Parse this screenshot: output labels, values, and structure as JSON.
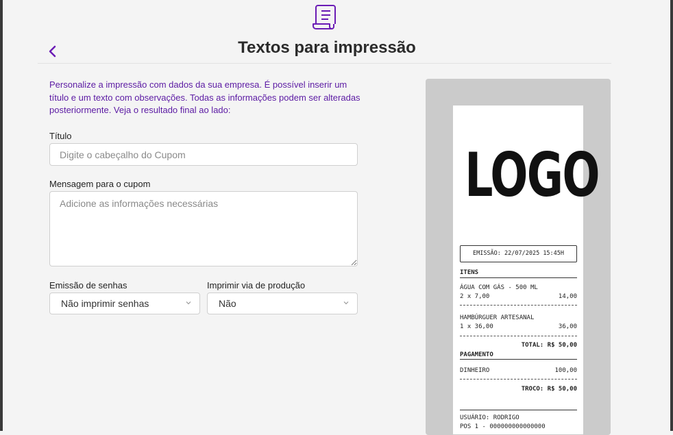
{
  "header": {
    "title": "Textos para impressão",
    "icon": "receipt-scroll-icon",
    "accent_color": "#6a1bb5"
  },
  "description": "Personalize a impressão com dados da sua empresa. É possível inserir um título e um texto com observações. Todas as informações podem ser alteradas posteriormente. Veja o resultado final ao lado:",
  "form": {
    "title_label": "Título",
    "title_placeholder": "Digite o cabeçalho do Cupom",
    "message_label": "Mensagem para o cupom",
    "message_placeholder": "Adicione as informações necessárias",
    "passwords_label": "Emissão de senhas",
    "passwords_value": "Não imprimir senhas",
    "production_label": "Imprimir via de produção",
    "production_value": "Não"
  },
  "receipt": {
    "logo": "LOGO",
    "emission": "EMISSÃO: 22/07/2025 15:45H",
    "items_header": "ITENS",
    "items": [
      {
        "name": "ÁGUA COM GÁS - 500 ML",
        "qty": "2 x 7,00",
        "total": "14,00"
      },
      {
        "name": "HAMBÚRGUER ARTESANAL",
        "qty": "1 x 36,00",
        "total": "36,00"
      }
    ],
    "total": "TOTAL: R$ 50,00",
    "payment_header": "PAGAMENTO",
    "payment_method": "DINHEIRO",
    "payment_value": "100,00",
    "change": "TROCO: R$ 50,00",
    "user": "USUÁRIO: RODRIGO",
    "pos": "POS 1 - 000000000000000"
  }
}
